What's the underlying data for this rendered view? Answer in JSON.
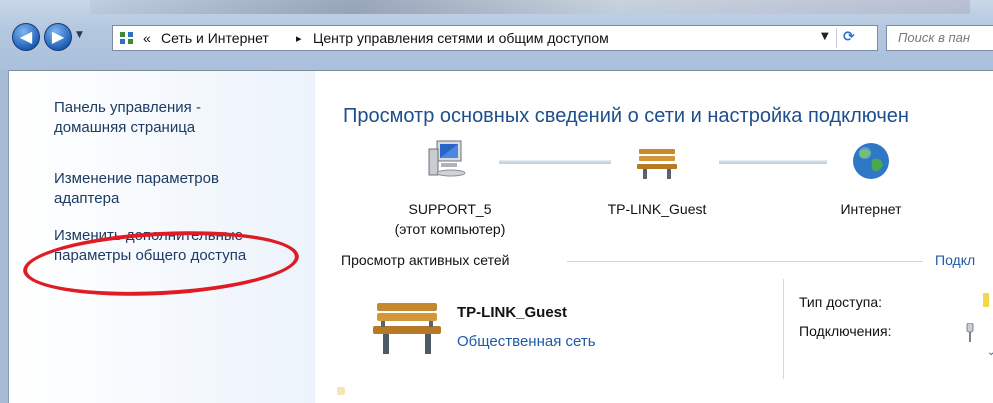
{
  "address_bar": {
    "overflow": "«",
    "crumbs": [
      "Сеть и Интернет",
      "Центр управления сетями и общим доступом"
    ],
    "crumb_separator": "▸",
    "search_placeholder": "Поиск в пан"
  },
  "nav_buttons": {
    "back_glyph": "◀",
    "forward_glyph": "▶",
    "dropdown_glyph": "▼",
    "refresh_glyph": "⟳"
  },
  "sidebar": {
    "links": [
      {
        "line1": "Панель управления -",
        "line2": "домашняя страница"
      },
      {
        "line1": "Изменение параметров",
        "line2": "адаптера"
      },
      {
        "line1": "Изменить дополнительные",
        "line2": "параметры общего доступа"
      }
    ],
    "highlight_color": "#e01b24"
  },
  "main": {
    "heading": "Просмотр основных сведений о сети и настройка подключен",
    "map": {
      "computer": {
        "name": "SUPPORT_5",
        "sub": "(этот компьютер)",
        "icon": "computer-icon"
      },
      "network": {
        "name": "TP-LINK_Guest",
        "icon": "bench-icon"
      },
      "internet": {
        "name": "Интернет",
        "icon": "globe-icon"
      }
    },
    "active_section": {
      "label": "Просмотр активных сетей",
      "link": "Подкл"
    },
    "active_network": {
      "name": "TP-LINK_Guest",
      "type": "Общественная сеть",
      "access_label": "Тип доступа:",
      "connections_label": "Подключения:"
    }
  },
  "colors": {
    "link": "#1e5aa8",
    "heading": "#1e4e8c",
    "nav_text": "#1d3b63"
  }
}
